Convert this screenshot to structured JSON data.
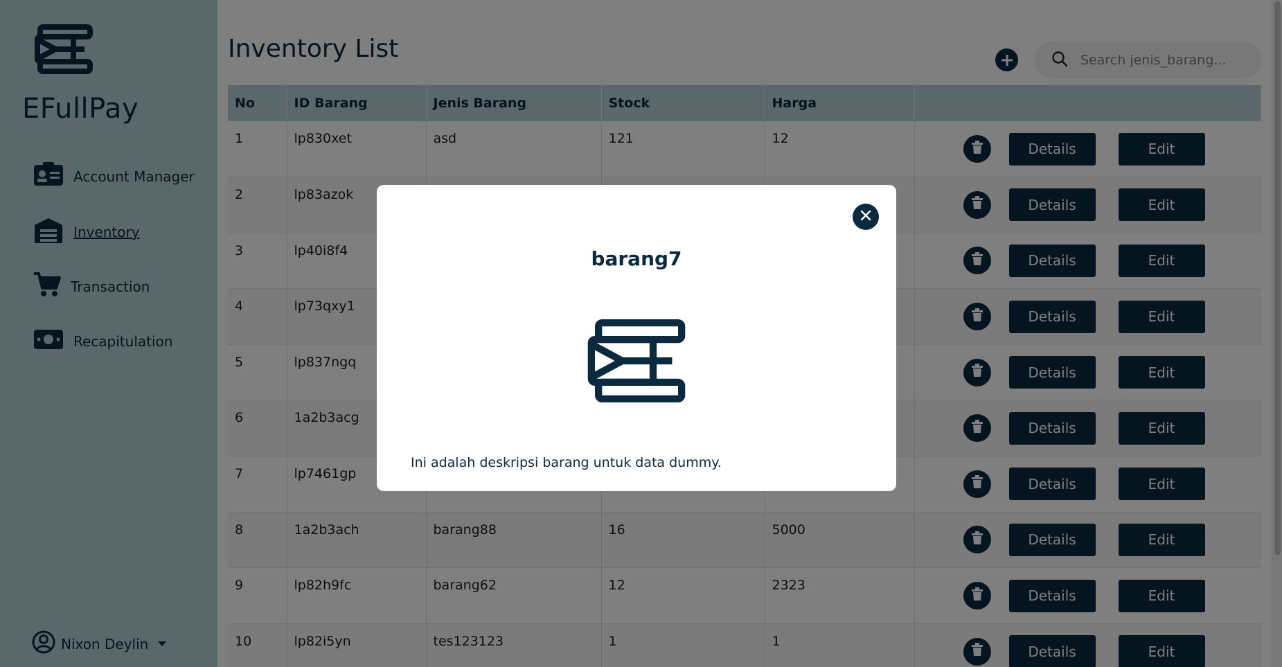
{
  "app": {
    "brand": "EFullPay"
  },
  "sidebar": {
    "items": [
      {
        "label": "Account Manager",
        "icon": "id-card-icon",
        "active": false
      },
      {
        "label": "Inventory",
        "icon": "warehouse-icon",
        "active": true
      },
      {
        "label": "Transaction",
        "icon": "cart-icon",
        "active": false
      },
      {
        "label": "Recapitulation",
        "icon": "money-icon",
        "active": false
      }
    ],
    "user": {
      "name": "Nixon Deylin",
      "icon": "user-circle-icon"
    }
  },
  "main": {
    "title": "Inventory List",
    "search": {
      "placeholder": "Search jenis_barang...",
      "value": ""
    },
    "table": {
      "columns": [
        "No",
        "ID Barang",
        "Jenis Barang",
        "Stock",
        "Harga",
        ""
      ],
      "rows": [
        {
          "no": "1",
          "id": "lp830xet",
          "jenis": "asd",
          "stock": "121",
          "harga": "12"
        },
        {
          "no": "2",
          "id": "lp83azok",
          "jenis": "",
          "stock": "",
          "harga": ""
        },
        {
          "no": "3",
          "id": "lp40i8f4",
          "jenis": "",
          "stock": "",
          "harga": ""
        },
        {
          "no": "4",
          "id": "lp73qxy1",
          "jenis": "",
          "stock": "",
          "harga": ""
        },
        {
          "no": "5",
          "id": "lp837ngq",
          "jenis": "",
          "stock": "",
          "harga": ""
        },
        {
          "no": "6",
          "id": "1a2b3acg",
          "jenis": "",
          "stock": "",
          "harga": ""
        },
        {
          "no": "7",
          "id": "lp7461gp",
          "jenis": "",
          "stock": "",
          "harga": ""
        },
        {
          "no": "8",
          "id": "1a2b3ach",
          "jenis": "barang88",
          "stock": "16",
          "harga": "5000"
        },
        {
          "no": "9",
          "id": "lp82h9fc",
          "jenis": "barang62",
          "stock": "12",
          "harga": "2323"
        },
        {
          "no": "10",
          "id": "lp82i5yn",
          "jenis": "tes123123",
          "stock": "1",
          "harga": "1"
        }
      ],
      "actions": {
        "details_label": "Details",
        "edit_label": "Edit"
      }
    }
  },
  "modal": {
    "title": "barang7",
    "description": "Ini adalah deskripsi barang untuk data dummy."
  },
  "colors": {
    "primary": "#0a2a3f",
    "sidebar": "#b6d0d6",
    "overlay": "rgba(0,0,0,0.5)"
  }
}
